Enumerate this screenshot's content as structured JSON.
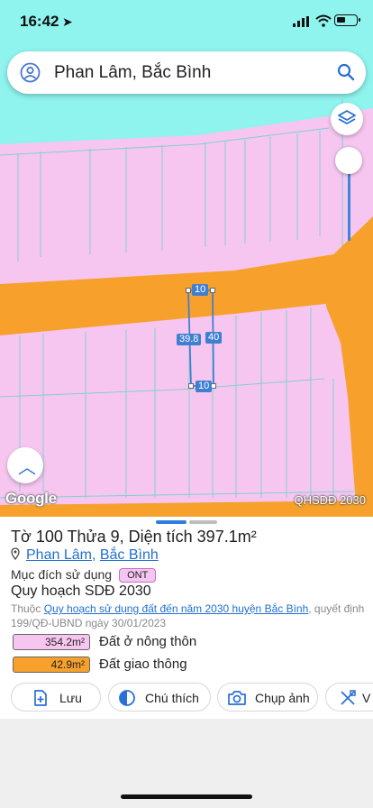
{
  "status_bar": {
    "time": "16:42"
  },
  "search": {
    "query": "Phan Lâm, Bắc Bình"
  },
  "map": {
    "dimension_labels": {
      "top": "10",
      "bottom": "10",
      "left": "39.8",
      "right": "40"
    },
    "google_logo": "Google",
    "layer_tag": "QHSDĐ 2030",
    "colors": {
      "residential": "#f7c6f0",
      "road": "#f7a12c",
      "water": "#8ff3ee",
      "parcel_line": "#7fd0d0"
    }
  },
  "sheet": {
    "title_prefix": "Tờ ",
    "sheet_no": "100",
    "title_mid": " Thửa ",
    "parcel_no": "9",
    "title_area_label": ", Diện tích ",
    "area": "397.1m²",
    "commune": "Phan Lâm",
    "separator": ", ",
    "district": "Bắc Bình",
    "purpose_label": "Mục đích sử dụng",
    "purpose_code": "ONT",
    "plan_title": "Quy hoạch SDĐ 2030",
    "source_prefix": "Thuộc ",
    "source_link": "Quy hoạch sử dụng đất đến năm 2030 huyện Bắc Bình",
    "source_suffix": ", quyết định 199/QĐ-UBND ngày 30/01/2023",
    "areas": [
      {
        "value": "354.2m²",
        "label": "Đất ở nông thôn",
        "color": "#f7c6f0"
      },
      {
        "value": "42.9m²",
        "label": "Đất giao thông",
        "color": "#f7a12c"
      }
    ],
    "actions": {
      "save": "Lưu",
      "legend": "Chú thích",
      "photo": "Chụp ảnh",
      "tools": "V"
    }
  }
}
